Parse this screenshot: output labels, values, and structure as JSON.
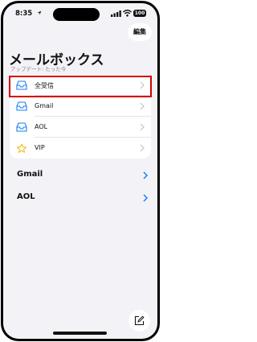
{
  "status": {
    "time": "8:35",
    "battery": "100"
  },
  "header": {
    "edit_label": "編集",
    "title": "メールボックス",
    "subtitle": "アップデート: たった今"
  },
  "mailboxes": [
    {
      "label": "全受信",
      "icon": "inbox-icon"
    },
    {
      "label": "Gmail",
      "icon": "inbox-icon"
    },
    {
      "label": "AOL",
      "icon": "inbox-icon"
    },
    {
      "label": "VIP",
      "icon": "star-icon"
    }
  ],
  "accounts": [
    {
      "label": "Gmail"
    },
    {
      "label": "AOL"
    }
  ],
  "colors": {
    "accent": "#1a7cf5",
    "highlight": "#d40000",
    "background": "#f2f2f7"
  }
}
